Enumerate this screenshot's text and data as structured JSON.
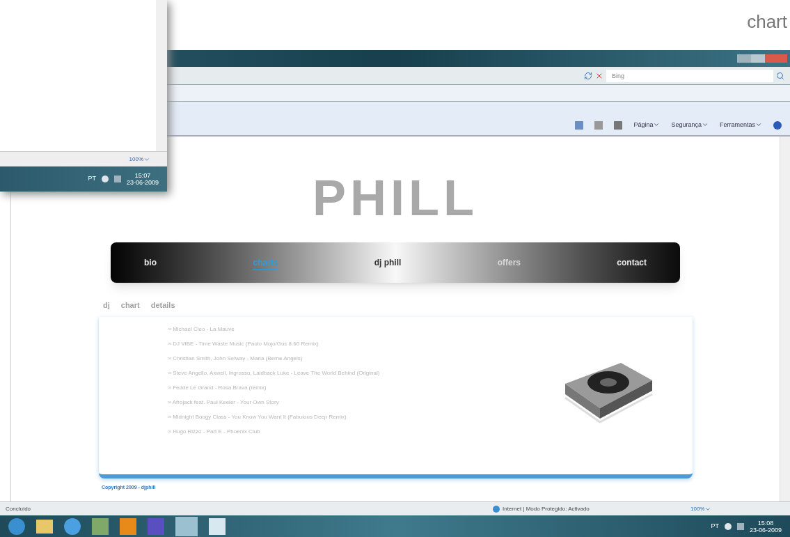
{
  "corner_label": "chart",
  "back_window": {
    "zoom": "100%",
    "taskbar": {
      "language": "PT",
      "time": "15:07",
      "date": "23-06-2009"
    }
  },
  "browser": {
    "search": {
      "placeholder": "Bing"
    },
    "commands": [
      "Página",
      "Segurança",
      "Ferramentas"
    ],
    "page": {
      "logo": "PHILL",
      "nav": [
        {
          "label": "bio",
          "selected": false,
          "color": "#e8e8e8"
        },
        {
          "label": "charts",
          "selected": true,
          "color": "#2f9bd8"
        },
        {
          "label": "dj phill",
          "selected": false,
          "color": "#333333"
        },
        {
          "label": "offers",
          "selected": false,
          "color": "#d8d8d8"
        },
        {
          "label": "contact",
          "selected": false,
          "color": "#e8e8e8"
        }
      ],
      "heading": [
        "dj",
        "chart",
        "details"
      ],
      "tracks": [
        "» Michael Cleo - La Mauve",
        "» DJ VIBE - Time Waste Music (Paolo Mojo/Gus 8.60 Remix)",
        "» Christian Smith, John Selway - Maria (Berne Angels)",
        "» Steve Angello, Axwell, Ingrosso, Laidback Luke - Leave The World Behind (Original)",
        "» Fedde Le Grand - Rosa Brava (remix)",
        "» Afrojack feat. Paul Keeler - Your Own Story",
        "» Midnight Boogy Class - You Know You Want It (Fabulous Deep Remix)",
        "» Hugo Rizzo - Part E - Phoenix Club"
      ],
      "copyright": "Copyright 2009 - djphill"
    },
    "status_bar": {
      "status": "Concluído",
      "zone": "Internet | Modo Protegido: Activado",
      "zoom": "100%"
    }
  },
  "taskbar": {
    "language": "PT",
    "time": "15:08",
    "date": "23-06-2009"
  }
}
